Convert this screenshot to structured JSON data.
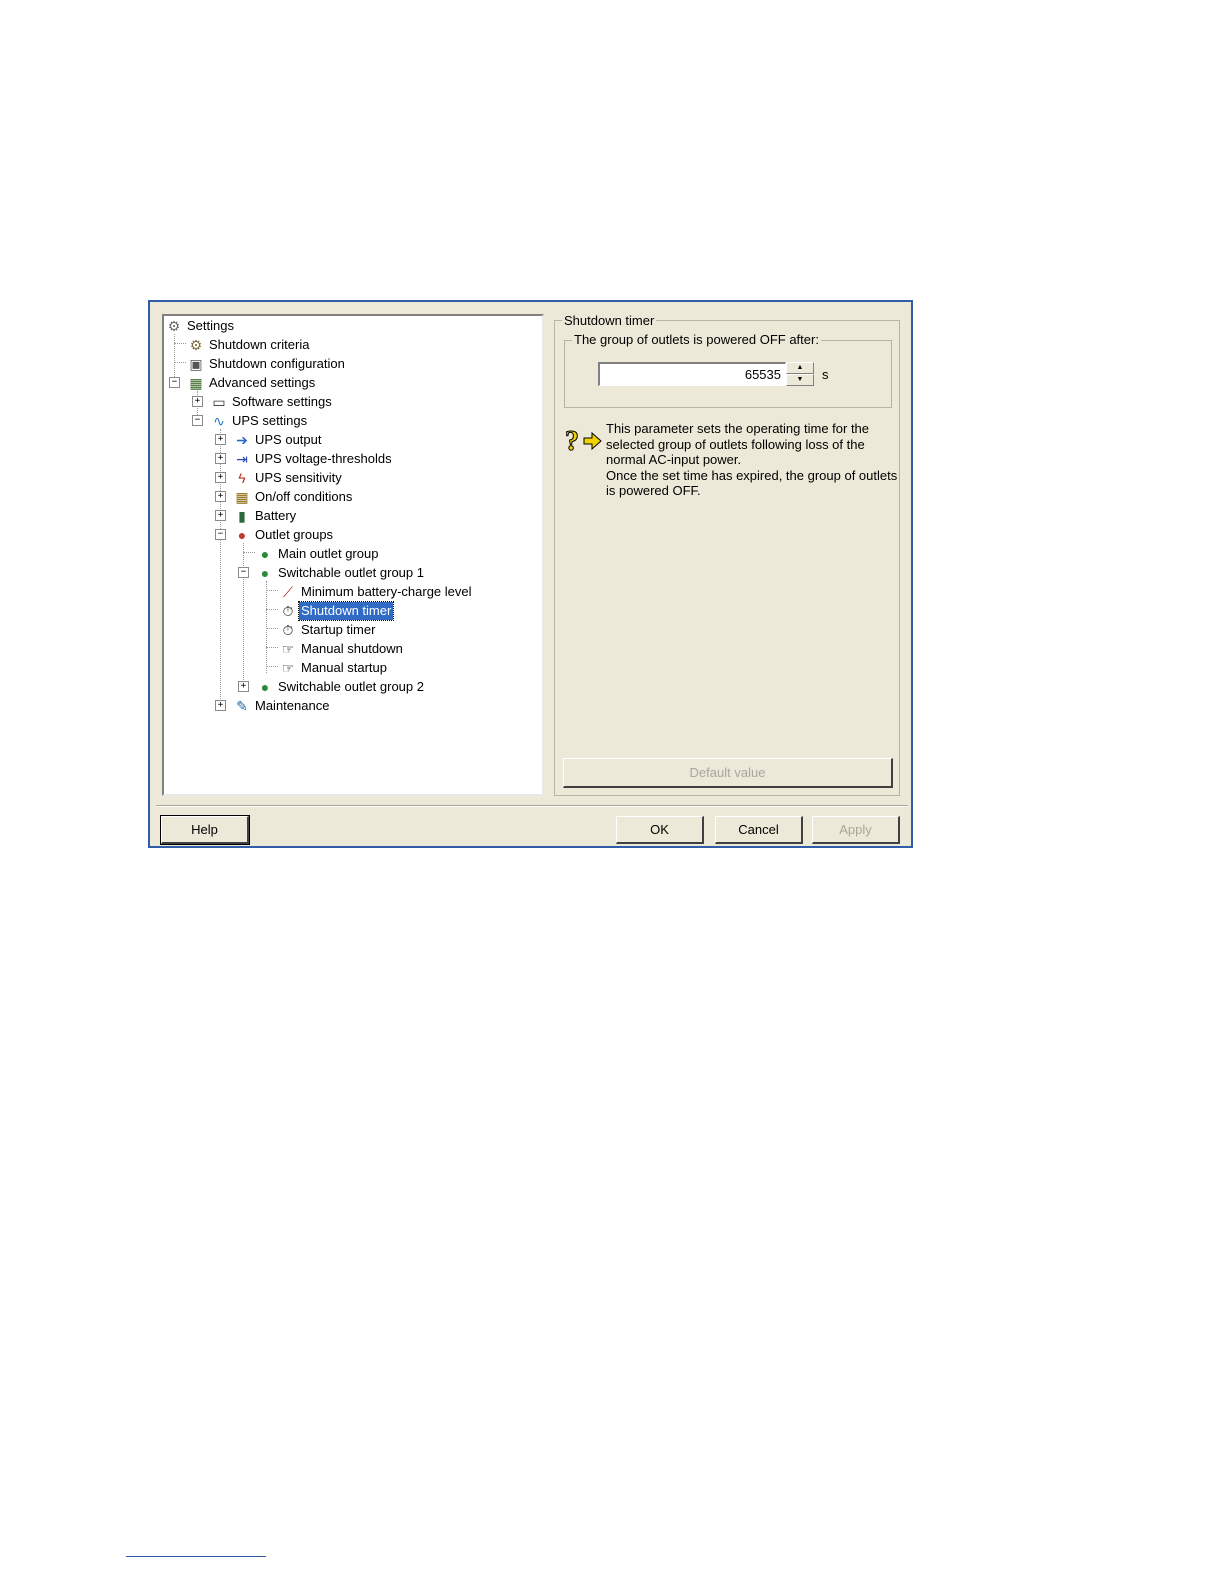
{
  "tree": {
    "nodes": [
      {
        "label": "Settings",
        "icon": "settings-icon"
      },
      {
        "label": "Shutdown criteria",
        "icon": "gears-icon"
      },
      {
        "label": "Shutdown configuration",
        "icon": "config-icon"
      },
      {
        "label": "Advanced settings",
        "icon": "advanced-icon"
      },
      {
        "label": "Software settings",
        "icon": "computer-icon"
      },
      {
        "label": "UPS settings",
        "icon": "ups-icon"
      },
      {
        "label": "UPS output",
        "icon": "output-icon"
      },
      {
        "label": "UPS voltage-thresholds",
        "icon": "voltage-icon"
      },
      {
        "label": "UPS sensitivity",
        "icon": "sensitivity-icon"
      },
      {
        "label": "On/off conditions",
        "icon": "onoff-icon"
      },
      {
        "label": "Battery",
        "icon": "battery-icon"
      },
      {
        "label": "Outlet groups",
        "icon": "outlet-groups-icon"
      },
      {
        "label": "Main outlet group",
        "icon": "outlet-icon"
      },
      {
        "label": "Switchable outlet group 1",
        "icon": "outlet-icon"
      },
      {
        "label": "Minimum battery-charge level",
        "icon": "wrench-icon"
      },
      {
        "label": "Shutdown timer",
        "icon": "stopwatch-icon",
        "selected": true
      },
      {
        "label": "Startup timer",
        "icon": "stopwatch-icon"
      },
      {
        "label": "Manual shutdown",
        "icon": "hand-icon"
      },
      {
        "label": "Manual startup",
        "icon": "hand-icon"
      },
      {
        "label": "Switchable outlet group 2",
        "icon": "outlet-icon"
      },
      {
        "label": "Maintenance",
        "icon": "maintenance-icon"
      }
    ]
  },
  "panel": {
    "group_title": "Shutdown timer",
    "inner_title": "The group of outlets is powered OFF after:",
    "value": "65535",
    "unit": "s",
    "help_lines": [
      "This parameter sets the operating time for the",
      "selected group of outlets following loss of the",
      "normal AC-input power.",
      "Once the set time has expired, the group of outlets",
      "is powered OFF."
    ],
    "default_button": "Default value"
  },
  "buttons": {
    "help": "Help",
    "ok": "OK",
    "cancel": "Cancel",
    "apply": "Apply"
  },
  "colors": {
    "dialog_border": "#2f5da8",
    "selection": "#316ac5",
    "face": "#ece9d8"
  }
}
